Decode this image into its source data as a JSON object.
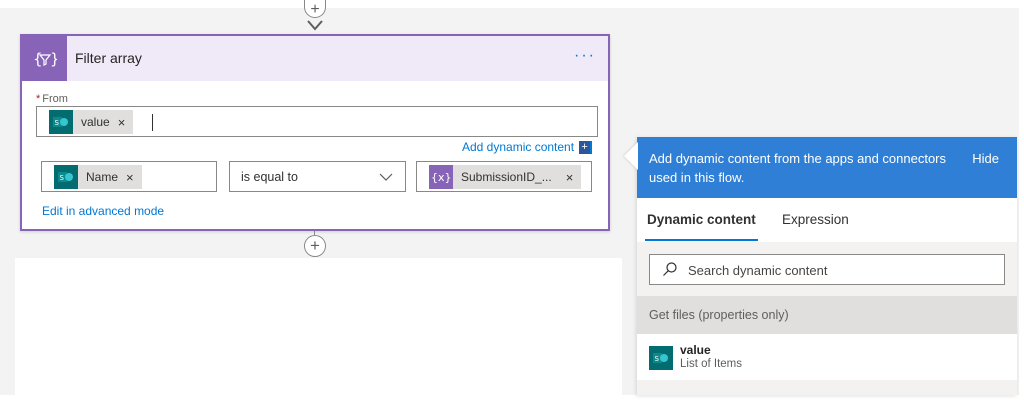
{
  "card": {
    "title": "Filter array",
    "menu_label": "···",
    "icon": "filter-expression-icon",
    "accent_color": "#8764b8",
    "from_label": "From",
    "required_marker": "*",
    "from_token": {
      "label": "value",
      "close": "×",
      "icon": "sharepoint-icon"
    },
    "add_dynamic_content": "Add dynamic content",
    "condition": {
      "left_token": {
        "label": "Name",
        "close": "×",
        "icon": "sharepoint-icon"
      },
      "operator": "is equal to",
      "right_token": {
        "label": "SubmissionID_...",
        "close": "×",
        "icon": "variable-expression-icon"
      }
    },
    "edit_advanced": "Edit in advanced mode"
  },
  "connectors": {
    "top_plus": "+",
    "bottom_plus": "+"
  },
  "flyout": {
    "description": "Add dynamic content from the apps and connectors used in this flow.",
    "hide_label": "Hide",
    "header_color": "#2f7fd6",
    "tabs": [
      {
        "label": "Dynamic content",
        "selected": true
      },
      {
        "label": "Expression",
        "selected": false
      }
    ],
    "search_placeholder": "Search dynamic content",
    "group_header": "Get files (properties only)",
    "items": [
      {
        "name": "value",
        "description": "List of Items",
        "icon": "sharepoint-icon"
      }
    ]
  }
}
